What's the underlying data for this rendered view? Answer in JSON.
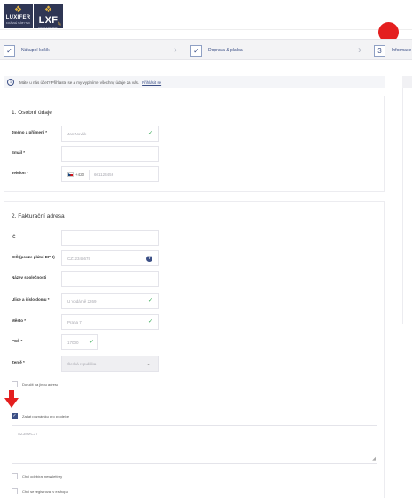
{
  "header": {
    "logo1": {
      "name": "LUXIFER",
      "sub": "KOŽENÉ NÁBYTEK"
    },
    "logo2": {
      "name": "LXF",
      "sub": "LUXUS DESIGN"
    }
  },
  "stepper": {
    "steps": [
      {
        "label": "Nákupní košík",
        "marker": "✓"
      },
      {
        "label": "Doprava & platba",
        "marker": "✓"
      },
      {
        "label": "Informace",
        "marker": "3"
      }
    ]
  },
  "notice": {
    "text": "Máte u nás účet? Přihlaste se a my vyplníme všechny údaje za vás.",
    "link": "Přihlásit se"
  },
  "personal": {
    "title": "1. Osobní údaje",
    "name_label": "Jméno a příjmení *",
    "name_value": "Jan Novák",
    "email_label": "Email *",
    "email_value": "",
    "phone_label": "Telefon *",
    "phone_code": "+420",
    "phone_value": "601123456"
  },
  "billing": {
    "title": "2. Fakturační adresa",
    "ic_label": "IČ",
    "dic_label": "DIČ (pouze plátci DPH)",
    "dic_value": "CZ12345678",
    "company_label": "Název společnosti",
    "street_label": "Ulice a číslo domu *",
    "street_value": "U Vodárně 2269",
    "city_label": "Město *",
    "city_value": "Praha 7",
    "zip_label": "PSČ *",
    "zip_value": "17000",
    "country_label": "Země *",
    "country_value": "Česká republika",
    "deliver_other": "Doručit na jinou adresu",
    "note_checkbox": "Zadat poznámku pro prodejce",
    "note_value": "AZ38MC37",
    "newsletter": "Chci odebírat newslettery",
    "register": "Chci se registrovat v e-shopu"
  },
  "colors": {
    "accent": "#3b4f86",
    "success": "#2fa84f",
    "highlight": "#e41f1f"
  }
}
